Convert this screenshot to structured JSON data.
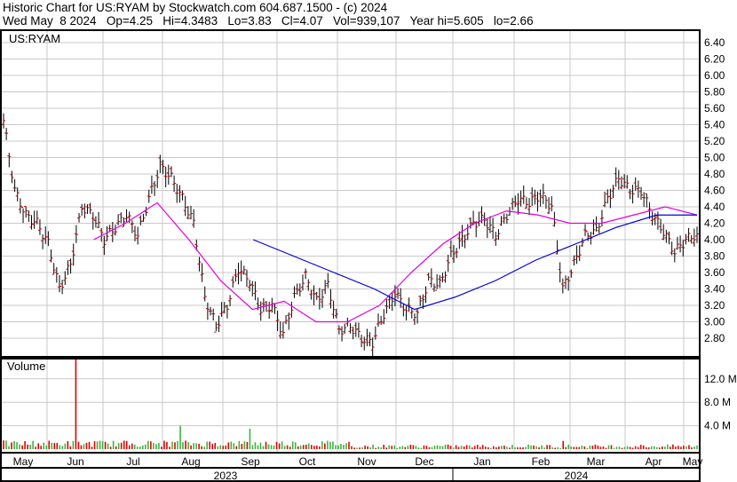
{
  "header": {
    "line1": "Historic Chart for US:RYAM by Stockwatch.com 604.687.1500 - (c) 2024",
    "line2": "Wed May  8 2024   Op=4.25   Hi=4.3483   Lo=3.83   Cl=4.07   Vol=939,107   Year hi=5.605   lo=2.66"
  },
  "chart_data": [
    {
      "type": "ohlc",
      "title": "US:RYAM",
      "ylim": [
        2.6,
        6.5
      ],
      "yticks": [
        "6.40",
        "6.20",
        "6.00",
        "5.80",
        "5.60",
        "5.40",
        "5.20",
        "5.00",
        "4.80",
        "4.60",
        "4.40",
        "4.20",
        "4.00",
        "3.80",
        "3.60",
        "3.40",
        "3.20",
        "3.00",
        "2.80"
      ],
      "close": [
        5.45,
        4.6,
        4.3,
        4.2,
        3.95,
        3.4,
        3.7,
        4.4,
        4.3,
        4.0,
        4.15,
        4.3,
        4.05,
        4.5,
        4.9,
        4.75,
        4.5,
        4.2,
        3.3,
        2.95,
        3.2,
        3.65,
        3.5,
        3.15,
        3.2,
        2.85,
        3.3,
        3.55,
        3.25,
        3.45,
        2.9,
        2.95,
        2.8,
        2.75,
        3.1,
        3.35,
        3.15,
        3.1,
        3.5,
        3.45,
        3.8,
        4.0,
        4.2,
        4.25,
        4.05,
        4.3,
        4.5,
        4.45,
        4.55,
        4.4,
        3.4,
        3.7,
        4.05,
        4.1,
        4.5,
        4.75,
        4.6,
        4.6,
        4.3,
        4.1,
        3.85,
        4.0,
        4.07
      ],
      "ma_short": {
        "color": "#e000e0",
        "start": 0.13,
        "values": [
          4.0,
          4.2,
          4.45,
          4.0,
          3.5,
          3.15,
          3.25,
          3.0,
          3.0,
          3.2,
          3.6,
          3.95,
          4.2,
          4.35,
          4.3,
          4.2,
          4.2,
          4.3,
          4.4,
          4.3
        ]
      },
      "ma_long": {
        "color": "#0000e0",
        "start": 0.36,
        "values": [
          4.0,
          3.8,
          3.6,
          3.4,
          3.15,
          3.3,
          3.5,
          3.75,
          3.95,
          4.15,
          4.3,
          4.3
        ]
      }
    },
    {
      "type": "bar",
      "title": "Volume",
      "yticks": [
        "12.0 M",
        "8.0 M",
        "4.0 M"
      ],
      "ylim": [
        0,
        16
      ],
      "spikes_millions": [
        {
          "pos": 0.105,
          "v": 16
        },
        {
          "pos": 0.255,
          "v": 4.0
        },
        {
          "pos": 0.355,
          "v": 3.5
        },
        {
          "pos": 0.807,
          "v": 1.4
        }
      ]
    }
  ],
  "xaxis": {
    "months": [
      "May",
      "Jun",
      "Jul",
      "Aug",
      "Sep",
      "Oct",
      "Nov",
      "Dec",
      "Jan",
      "Feb",
      "Mar",
      "Apr",
      "May"
    ],
    "years": [
      "2023",
      "2024"
    ]
  }
}
